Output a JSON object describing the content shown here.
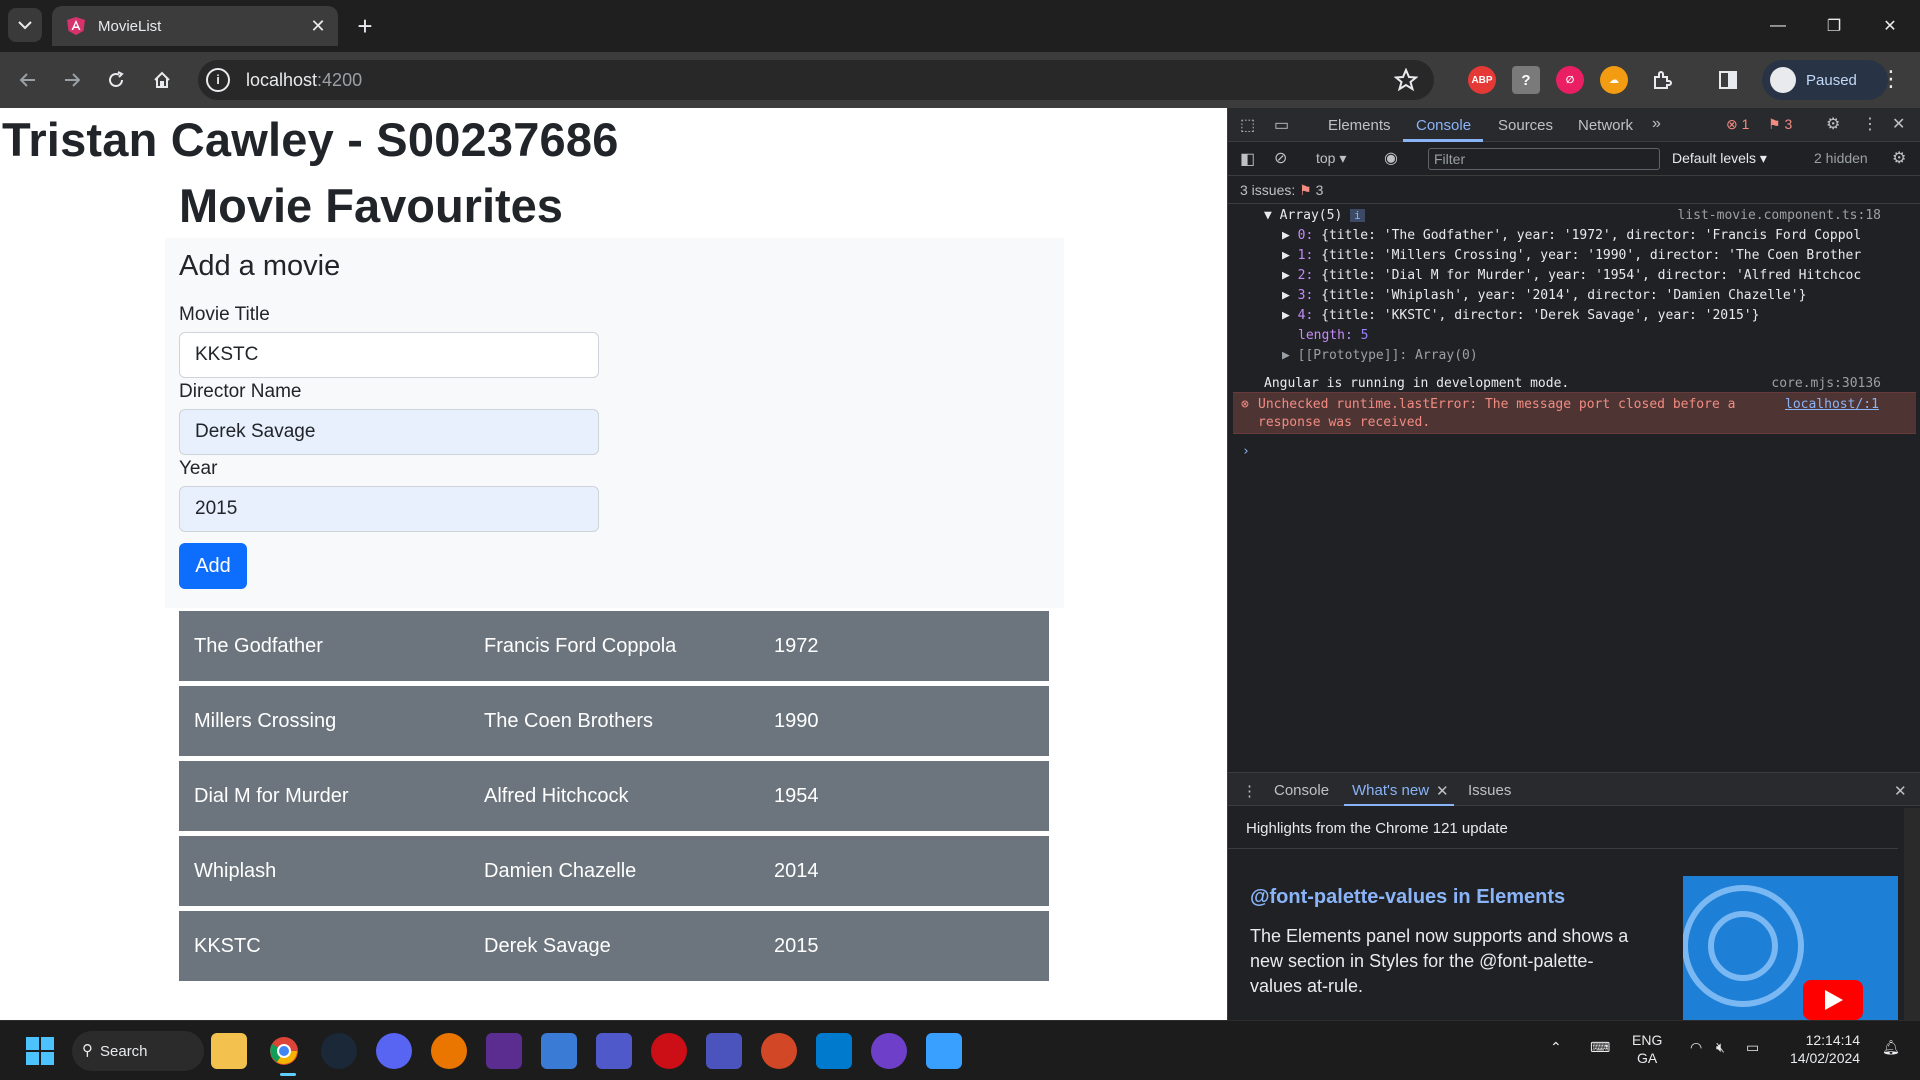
{
  "browser": {
    "tab_title": "MovieList",
    "url_host": "localhost",
    "url_port": ":4200",
    "profile_label": "Paused",
    "extensions": [
      "ABP",
      "?",
      "∅",
      "☁"
    ]
  },
  "page": {
    "student_title": "Tristan Cawley - S00237686",
    "heading": "Movie Favourites",
    "form": {
      "title": "Add a movie",
      "title_label": "Movie Title",
      "title_value": "KKSTC",
      "director_label": "Director Name",
      "director_value": "Derek Savage",
      "year_label": "Year",
      "year_value": "2015",
      "add_label": "Add"
    },
    "movies": [
      {
        "title": "The Godfather",
        "director": "Francis Ford Coppola",
        "year": "1972"
      },
      {
        "title": "Millers Crossing",
        "director": "The Coen Brothers",
        "year": "1990"
      },
      {
        "title": "Dial M for Murder",
        "director": "Alfred Hitchcock",
        "year": "1954"
      },
      {
        "title": "Whiplash",
        "director": "Damien Chazelle",
        "year": "2014"
      },
      {
        "title": "KKSTC",
        "director": "Derek Savage",
        "year": "2015"
      }
    ]
  },
  "devtools": {
    "tabs": [
      "Elements",
      "Console",
      "Sources",
      "Network"
    ],
    "error_count": "1",
    "issue_count": "3",
    "context": "top",
    "filter_placeholder": "Filter",
    "levels": "Default levels",
    "hidden": "2 hidden",
    "issues_label": "3 issues:",
    "issues_num": "3",
    "array_label": "Array(5)",
    "array_source": "list-movie.component.ts:18",
    "array_items": [
      {
        "idx": "0:",
        "text": "{title: 'The Godfather', year: '1972', director: 'Francis Ford Coppol"
      },
      {
        "idx": "1:",
        "text": "{title: 'Millers Crossing', year: '1990', director: 'The Coen Brother"
      },
      {
        "idx": "2:",
        "text": "{title: 'Dial M for Murder', year: '1954', director: 'Alfred Hitchcoc"
      },
      {
        "idx": "3:",
        "text": "{title: 'Whiplash', year: '2014', director: 'Damien Chazelle'}"
      },
      {
        "idx": "4:",
        "text": "{title: 'KKSTC', director: 'Derek Savage', year: '2015'}"
      }
    ],
    "length_label": "length:",
    "length_value": "5",
    "prototype": "[[Prototype]]: Array(0)",
    "angular_msg": "Angular is running in development mode.",
    "angular_src": "core.mjs:30136",
    "error_line1": "Unchecked runtime.lastError: The message port closed before a",
    "error_line2": "response was received.",
    "error_src": "localhost/:1",
    "drawer_tabs": [
      "Console",
      "What's new",
      "Issues"
    ],
    "whatsnew_sub": "Highlights from the Chrome 121 update",
    "whatsnew_title": "@font-palette-values in Elements",
    "whatsnew_text": "The Elements panel now supports and shows a new section in Styles for the @font-palette-values at-rule."
  },
  "taskbar": {
    "search_label": "Search",
    "lang": "ENG",
    "lang2": "GA",
    "time": "12:14:14",
    "date": "14/02/2024"
  },
  "colors": {
    "accent": "#0d6efd",
    "row_bg": "#6c757d",
    "devtools_link": "#8ab4f8"
  }
}
